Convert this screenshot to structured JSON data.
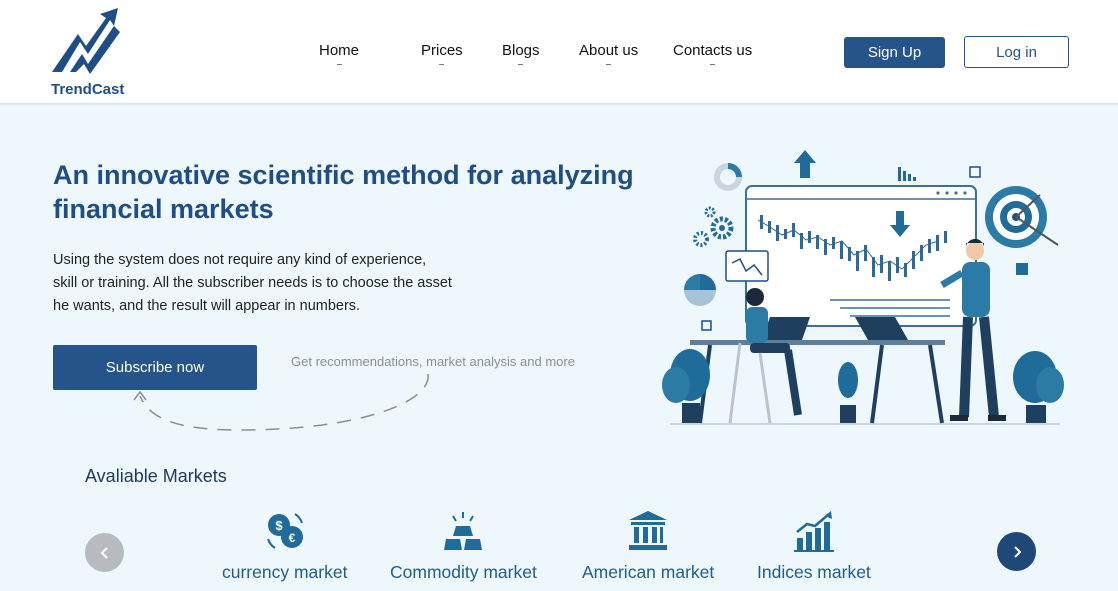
{
  "header": {
    "logo_text": "TrendCast",
    "nav": [
      {
        "label": "Home"
      },
      {
        "label": "Prices"
      },
      {
        "label": "Blogs"
      },
      {
        "label": "About us"
      },
      {
        "label": "Contacts us"
      }
    ],
    "signup_label": "Sign Up",
    "login_label": "Log in"
  },
  "hero": {
    "title": "An innovative scientific method for analyzing financial markets",
    "description": "Using the system does not require any kind of experience, skill or training. All the subscriber needs is to choose the asset he wants, and the result will appear in numbers.",
    "subscribe_label": "Subscribe now",
    "note": "Get recommendations, market analysis and more"
  },
  "markets": {
    "title": "Avaliable Markets",
    "items": [
      {
        "label": "currency market",
        "icon": "currency-exchange-icon"
      },
      {
        "label": "Commodity market",
        "icon": "gold-bars-icon"
      },
      {
        "label": "American market",
        "icon": "bank-icon"
      },
      {
        "label": "Indices market",
        "icon": "bar-chart-growth-icon"
      }
    ]
  },
  "colors": {
    "brand": "#24548a",
    "heading": "#1f4e86",
    "market_label": "#1f5d8b",
    "background": "#eef7fb"
  }
}
